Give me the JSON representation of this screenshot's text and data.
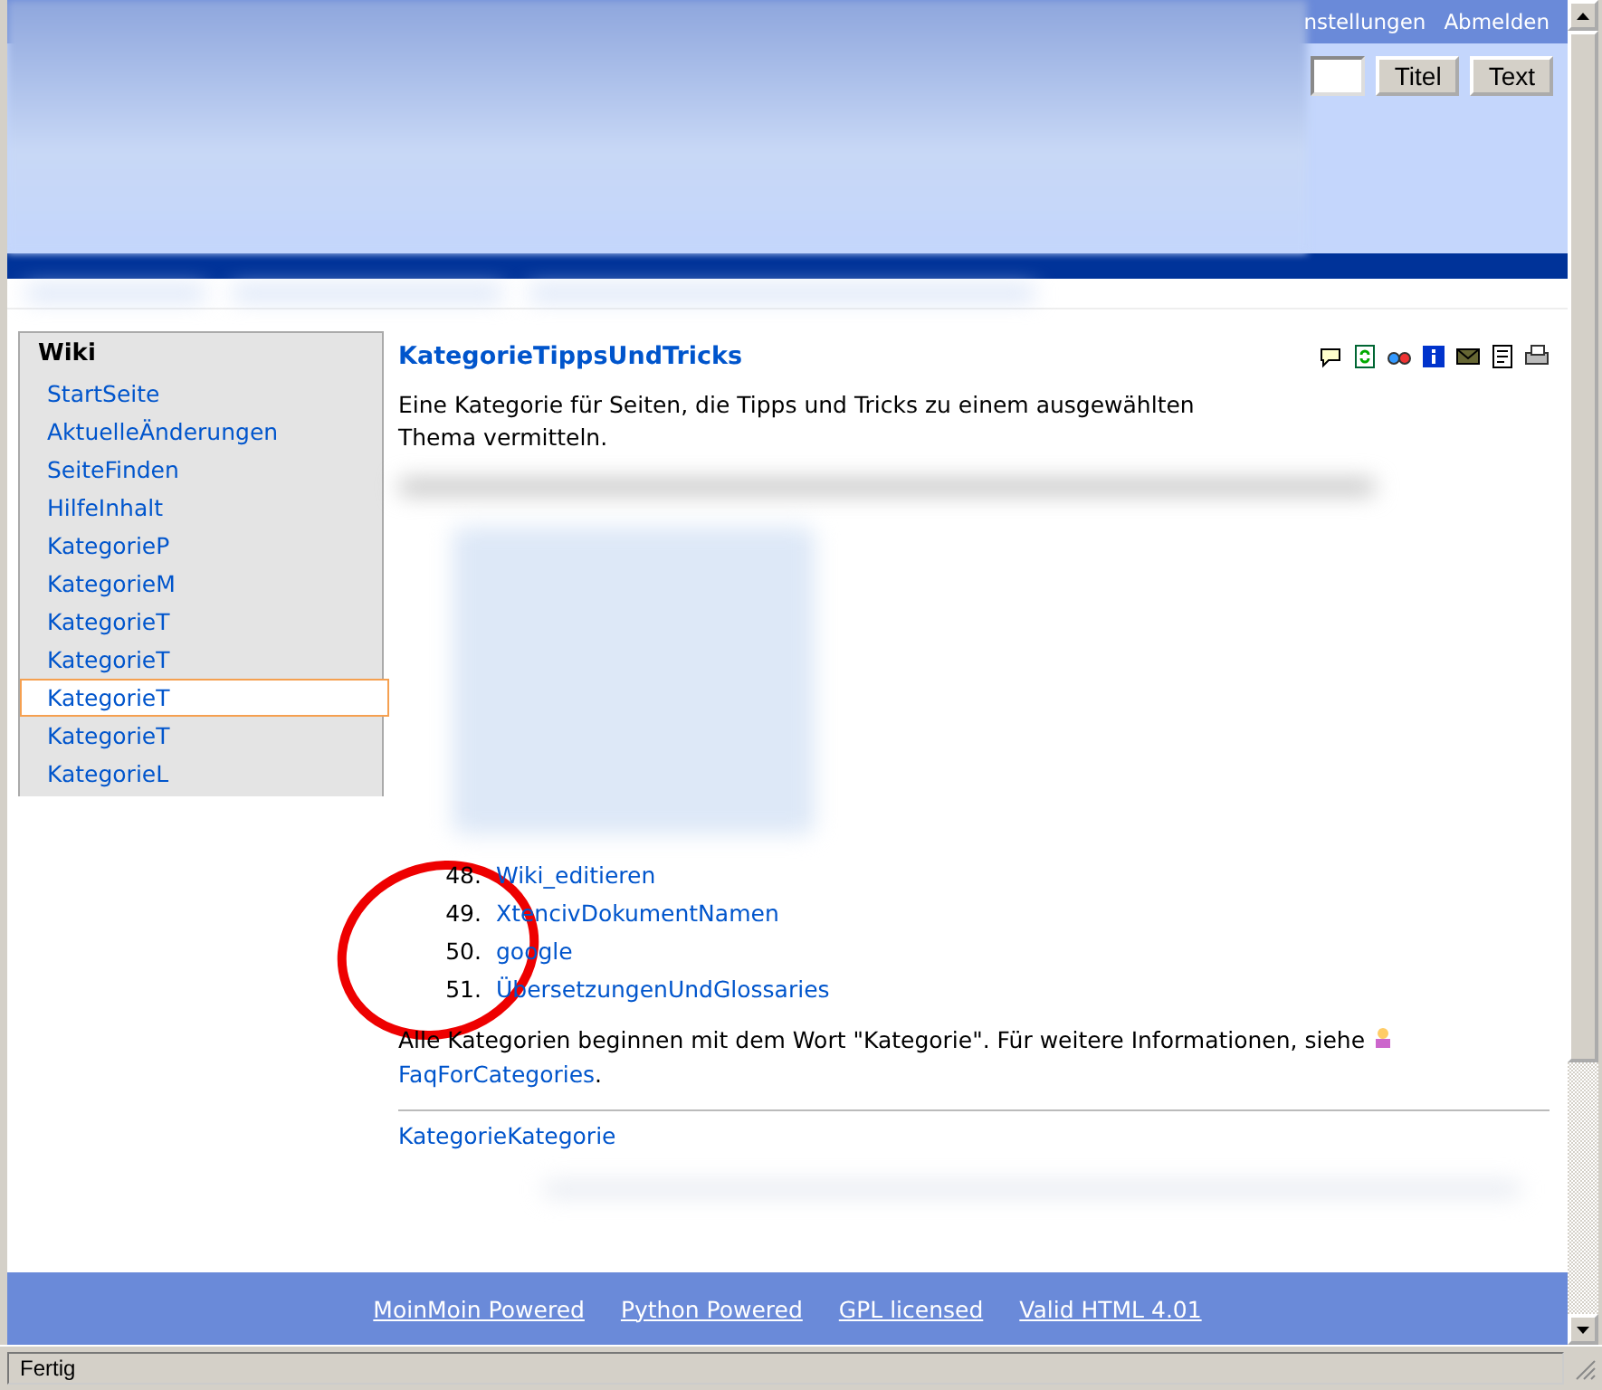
{
  "header": {
    "user_links": [
      "nstellungen",
      "Abmelden"
    ],
    "search_buttons": [
      "Titel",
      "Text"
    ]
  },
  "sidebar": {
    "title": "Wiki",
    "items": [
      {
        "label": "StartSeite",
        "selected": false
      },
      {
        "label": "AktuelleÄnderungen",
        "selected": false
      },
      {
        "label": "SeiteFinden",
        "selected": false
      },
      {
        "label": "HilfeInhalt",
        "selected": false
      },
      {
        "label": "KategorieP",
        "selected": false
      },
      {
        "label": "KategorieM",
        "selected": false
      },
      {
        "label": "KategorieT",
        "selected": false
      },
      {
        "label": "KategorieT",
        "selected": false
      },
      {
        "label": "KategorieT",
        "selected": true
      },
      {
        "label": "KategorieT",
        "selected": false
      },
      {
        "label": "KategorieL",
        "selected": false
      }
    ]
  },
  "page": {
    "title": "KategorieTippsUndTricks",
    "description": "Eine Kategorie für Seiten, die Tipps und Tricks zu einem ausgewählten Thema vermitteln.",
    "list": [
      {
        "number": "48.",
        "label": "Wiki_editieren"
      },
      {
        "number": "49.",
        "label": "XtencivDokumentNamen"
      },
      {
        "number": "50.",
        "label": "google"
      },
      {
        "number": "51.",
        "label": "ÜbersetzungenUndGlossaries"
      }
    ],
    "note": "Alle Kategorien beginnen mit dem Wort \"Kategorie\". Für weitere Informationen, siehe",
    "note_link": "FaqForCategories",
    "note_end": ".",
    "category_link": "KategorieKategorie"
  },
  "footer": {
    "links": [
      "MoinMoin Powered",
      "Python Powered",
      "GPL licensed",
      "Valid HTML 4.01"
    ]
  },
  "status_bar": {
    "text": "Fertig"
  }
}
